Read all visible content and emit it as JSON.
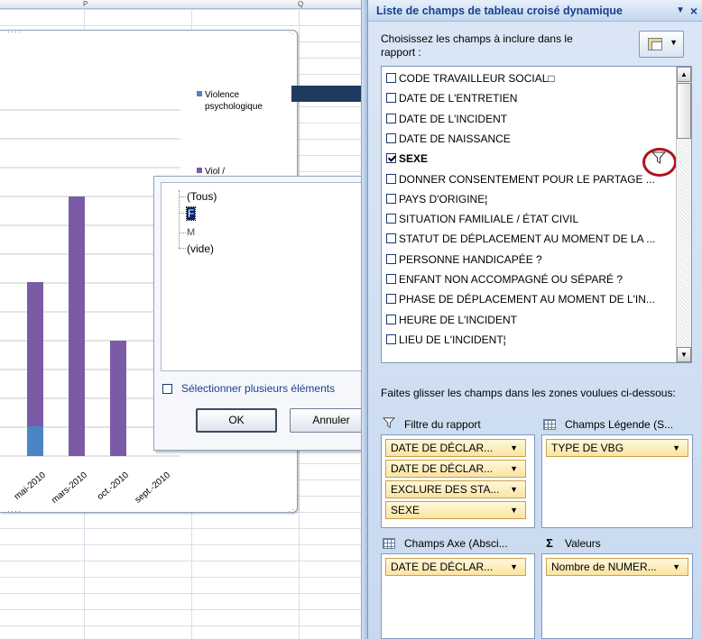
{
  "sheet": {
    "col_letters": [
      "P",
      "Q"
    ],
    "legend": [
      "Violence psychologique",
      "Viol /"
    ],
    "x_labels": [
      "mai-2010",
      "mars-2010",
      "oct.-2010",
      "sept.-2010"
    ]
  },
  "chart_data": {
    "type": "bar",
    "categories": [
      "mai-2010",
      "mars-2010",
      "oct.-2010",
      "sept.-2010"
    ],
    "series": [
      {
        "name": "Violence psychologique",
        "color": "#4a86c5",
        "values": [
          33,
          0,
          0,
          0
        ]
      },
      {
        "name": "Viol /",
        "color": "#7c5ba6",
        "values": [
          160,
          288,
          128,
          0
        ]
      }
    ],
    "grid": true
  },
  "filter_popup": {
    "items": [
      "(Tous)",
      "F",
      "M",
      "(vide)"
    ],
    "selected_index": 1,
    "multi_select_label": "Sélectionner plusieurs éléments",
    "ok_label": "OK",
    "cancel_label": "Annuler"
  },
  "pane": {
    "title": "Liste de champs de tableau croisé dynamique",
    "choose_label": "Choisissez les champs à inclure dans le rapport :",
    "fields": [
      {
        "label": "CODE TRAVAILLEUR SOCIAL□",
        "checked": false
      },
      {
        "label": "DATE DE L'ENTRETIEN",
        "checked": false
      },
      {
        "label": "DATE DE L'INCIDENT",
        "checked": false
      },
      {
        "label": "DATE DE NAISSANCE",
        "checked": false
      },
      {
        "label": "SEXE",
        "checked": true
      },
      {
        "label": "DONNER CONSENTEMENT POUR LE PARTAGE ...",
        "checked": false
      },
      {
        "label": "PAYS D'ORIGINE¦",
        "checked": false
      },
      {
        "label": "SITUATION FAMILIALE / ÉTAT CIVIL",
        "checked": false
      },
      {
        "label": "STATUT DE DÉPLACEMENT AU MOMENT DE LA ...",
        "checked": false
      },
      {
        "label": "PERSONNE HANDICAPÉE ?",
        "checked": false
      },
      {
        "label": "ENFANT NON ACCOMPAGNÉ OU SÉPARÉ ?",
        "checked": false
      },
      {
        "label": "PHASE DE DÉPLACEMENT AU MOMENT DE L'IN...",
        "checked": false
      },
      {
        "label": "HEURE DE L'INCIDENT",
        "checked": false
      },
      {
        "label": "LIEU DE L'INCIDENT¦",
        "checked": false
      }
    ],
    "drag_label": "Faites glisser les champs dans les zones voulues ci-dessous:",
    "zones": {
      "report_filter": {
        "title": "Filtre du rapport",
        "items": [
          "DATE DE DÉCLAR...",
          "DATE DE DÉCLAR...",
          "EXCLURE DES STA...",
          "SEXE"
        ]
      },
      "legend_fields": {
        "title": "Champs Légende (S...",
        "items": [
          "TYPE DE VBG"
        ]
      },
      "axis_fields": {
        "title": "Champs Axe (Absci...",
        "items": [
          "DATE DE DÉCLAR..."
        ]
      },
      "values": {
        "title": "Valeurs",
        "items": [
          "Nombre de NUMER..."
        ]
      }
    }
  }
}
